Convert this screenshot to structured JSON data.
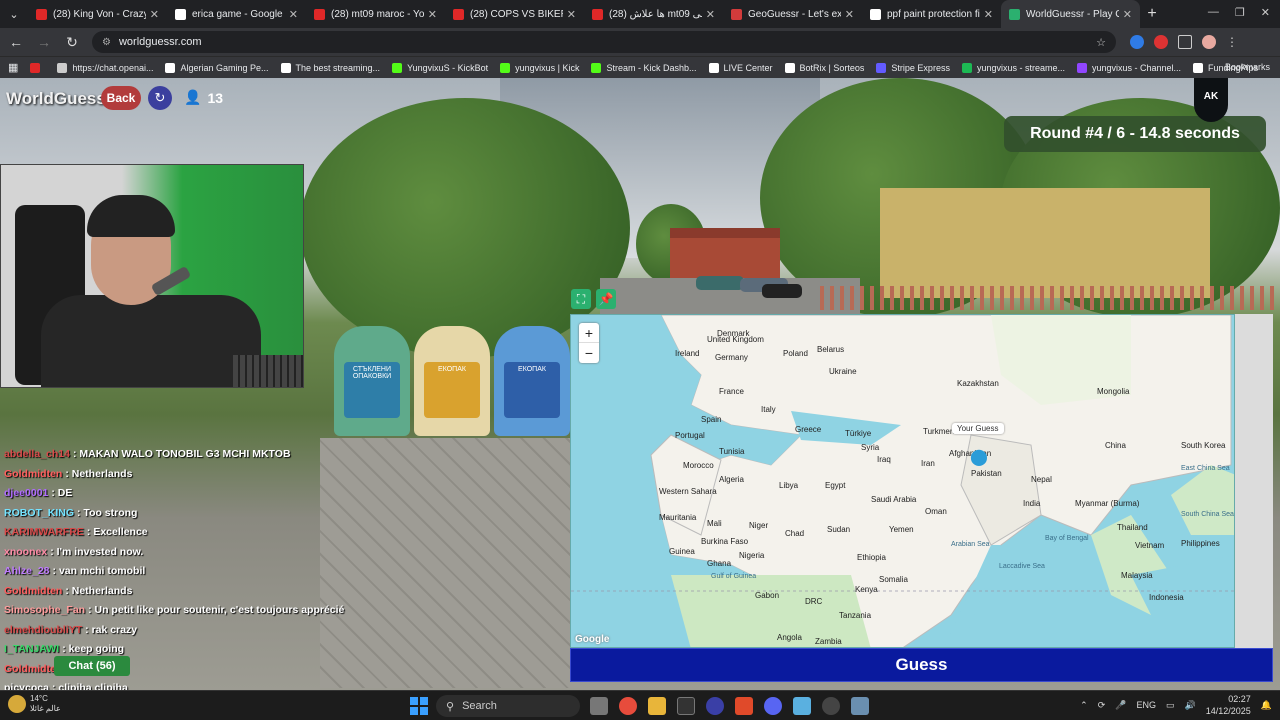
{
  "browser": {
    "tabs": [
      {
        "title": "(28) King Von - Crazy Story",
        "fav_color": "#e02828",
        "active": false
      },
      {
        "title": "erica game - Google Search",
        "fav_color": "#ffffff",
        "active": false
      },
      {
        "title": "(28) mt09 maroc - YouTube",
        "fav_color": "#e02828",
        "active": false
      },
      {
        "title": "(28) COPS VS BIKERS | MOTO",
        "fav_color": "#e02828",
        "active": false
      },
      {
        "title": "(28) ها علاش mt09 كاتبقى",
        "fav_color": "#e02828",
        "active": false
      },
      {
        "title": "GeoGuessr - Let's explore",
        "fav_color": "#d23b3b",
        "active": false
      },
      {
        "title": "ppf paint protection film",
        "fav_color": "#ffffff",
        "active": false
      },
      {
        "title": "WorldGuessr - Play Geography",
        "fav_color": "#2bb06f",
        "active": true
      }
    ],
    "url": "worldguessr.com",
    "bookmarks": [
      {
        "label": "",
        "color": "#e02828"
      },
      {
        "label": "https://chat.openai...",
        "color": "#cccccc"
      },
      {
        "label": "Algerian Gaming Pe...",
        "color": "#ffffff"
      },
      {
        "label": "The best streaming...",
        "color": "#ffffff"
      },
      {
        "label": "YungvixuS - KickBot",
        "color": "#53fc18"
      },
      {
        "label": "yungvixus | Kick",
        "color": "#53fc18"
      },
      {
        "label": "Stream - Kick Dashb...",
        "color": "#53fc18"
      },
      {
        "label": "LIVE Center",
        "color": "#ffffff"
      },
      {
        "label": "BotRix | Sorteos",
        "color": "#ffffff"
      },
      {
        "label": "Stripe Express",
        "color": "#635bff"
      },
      {
        "label": "yungvixus - streame...",
        "color": "#1db954"
      },
      {
        "label": "yungvixus - Channel...",
        "color": "#9146ff"
      },
      {
        "label": "FundingPips",
        "color": "#ffffff"
      }
    ],
    "bookmarks_all": "Bookmarks"
  },
  "game": {
    "logo": "WorldGuessr",
    "back_label": "Back",
    "player_count": "13",
    "round_text": "Round #4 / 6 - 14.8 seconds",
    "guess_label": "Guess",
    "ak_logo": "AK"
  },
  "chat": {
    "messages": [
      {
        "user": "abdella_ch14",
        "text": ": MAKAN WALO TONOBIL G3 MCHI MKTOB",
        "color": "#d84a4a"
      },
      {
        "user": "Goldmidten",
        "text": ": Netherlands",
        "color": "#ff5d5d"
      },
      {
        "user": "djee0001",
        "text": ": DE",
        "color": "#b06cff"
      },
      {
        "user": "ROBOT_KING",
        "text": ": Too strong",
        "color": "#74e3ff"
      },
      {
        "user": "KARIMWARFRE",
        "text": ": Excellence",
        "color": "#d84a4a"
      },
      {
        "user": "xnoonex",
        "text": ": I'm invested now.",
        "color": "#ff8aa6"
      },
      {
        "user": "Ahlze_28",
        "text": ": van mchi tomobil",
        "color": "#c07cff"
      },
      {
        "user": "Goldmidten",
        "text": ": Netherlands",
        "color": "#ff5d5d"
      },
      {
        "user": "Simosophe_Fan",
        "text": ": Un petit like pour soutenir, c'est toujours apprécié",
        "color": "#ff9d9d"
      },
      {
        "user": "elmehdioubliYT",
        "text": ": rak crazy",
        "color": "#d84a4a"
      },
      {
        "user": "I_TANJAWI",
        "text": ": keep going",
        "color": "#3ad86a"
      },
      {
        "user": "Goldmidten",
        "text": ": Poland",
        "color": "#ff5d5d"
      },
      {
        "user": "picycoca",
        "text": ": clipiha clipiha",
        "color": "#ffffff"
      }
    ],
    "chat_button": "Chat (56)"
  },
  "map": {
    "guess_tooltip": "Your Guess",
    "zoom_in": "+",
    "zoom_out": "−",
    "google": "Google",
    "labels": [
      {
        "name": "Denmark"
      },
      {
        "name": "United Kingdom"
      },
      {
        "name": "Ireland"
      },
      {
        "name": "Belarus"
      },
      {
        "name": "Germany"
      },
      {
        "name": "Poland"
      },
      {
        "name": "Ukraine"
      },
      {
        "name": "France"
      },
      {
        "name": "Italy"
      },
      {
        "name": "Spain"
      },
      {
        "name": "Portugal"
      },
      {
        "name": "Greece"
      },
      {
        "name": "Türkiye"
      },
      {
        "name": "Kazakhstan"
      },
      {
        "name": "Mongolia"
      },
      {
        "name": "Turkmenistan"
      },
      {
        "name": "Syria"
      },
      {
        "name": "Iraq"
      },
      {
        "name": "Iran"
      },
      {
        "name": "Afghanistan"
      },
      {
        "name": "Pakistan"
      },
      {
        "name": "China"
      },
      {
        "name": "South Korea"
      },
      {
        "name": "Nepal"
      },
      {
        "name": "India"
      },
      {
        "name": "Tunisia"
      },
      {
        "name": "Morocco"
      },
      {
        "name": "Algeria"
      },
      {
        "name": "Libya"
      },
      {
        "name": "Egypt"
      },
      {
        "name": "Saudi Arabia"
      },
      {
        "name": "Oman"
      },
      {
        "name": "Western Sahara"
      },
      {
        "name": "Mauritania"
      },
      {
        "name": "Mali"
      },
      {
        "name": "Niger"
      },
      {
        "name": "Chad"
      },
      {
        "name": "Sudan"
      },
      {
        "name": "Yemen"
      },
      {
        "name": "Burkina Faso"
      },
      {
        "name": "Guinea"
      },
      {
        "name": "Nigeria"
      },
      {
        "name": "Ghana"
      },
      {
        "name": "Ethiopia"
      },
      {
        "name": "Somalia"
      },
      {
        "name": "Kenya"
      },
      {
        "name": "Gabon"
      },
      {
        "name": "DRC"
      },
      {
        "name": "Tanzania"
      },
      {
        "name": "Angola"
      },
      {
        "name": "Zambia"
      },
      {
        "name": "Myanmar (Burma)"
      },
      {
        "name": "Thailand"
      },
      {
        "name": "Vietnam"
      },
      {
        "name": "Philippines"
      },
      {
        "name": "Malaysia"
      },
      {
        "name": "Indonesia"
      },
      {
        "name": "Bay of Bengal"
      },
      {
        "name": "Arabian Sea"
      },
      {
        "name": "Laccadive Sea"
      },
      {
        "name": "Gulf of Guinea"
      },
      {
        "name": "East China Sea"
      },
      {
        "name": "South China Sea"
      }
    ]
  },
  "taskbar": {
    "temp": "14°C",
    "weather_text": "عالم غائلا",
    "search_label": "Search",
    "lang": "ENG",
    "time": "02:27",
    "date": "14/12/2025"
  }
}
